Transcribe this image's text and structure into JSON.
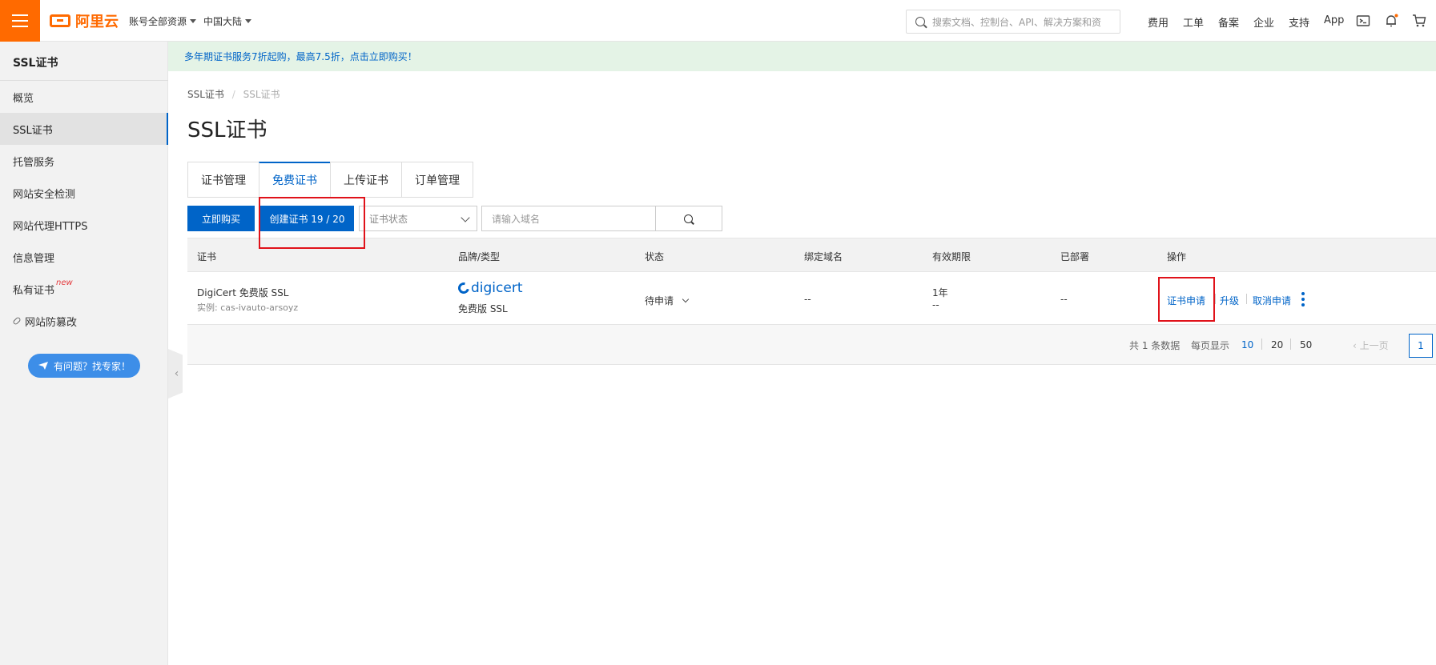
{
  "topbar": {
    "logo_text": "阿里云",
    "account_dropdown": "账号全部资源",
    "region_dropdown": "中国大陆",
    "search_placeholder": "搜索文档、控制台、API、解决方案和资",
    "links": [
      "费用",
      "工单",
      "备案",
      "企业",
      "支持",
      "App"
    ],
    "brand_color": "#ff6a00"
  },
  "sidebar": {
    "title": "SSL证书",
    "items": [
      {
        "label": "概览"
      },
      {
        "label": "SSL证书"
      },
      {
        "label": "托管服务"
      },
      {
        "label": "网站安全检测"
      },
      {
        "label": "网站代理HTTPS"
      },
      {
        "label": "信息管理"
      },
      {
        "label": "私有证书",
        "badge": "new"
      },
      {
        "label": "网站防篡改"
      }
    ],
    "expert_button": "有问题？找专家！"
  },
  "banner": {
    "text": "多年期证书服务7折起购，最高7.5折，点击立即购买！"
  },
  "breadcrumb": {
    "root": "SSL证书",
    "current": "SSL证书"
  },
  "page_title": "SSL证书",
  "tabs": [
    {
      "label": "证书管理"
    },
    {
      "label": "免费证书"
    },
    {
      "label": "上传证书"
    },
    {
      "label": "订单管理"
    }
  ],
  "toolbar": {
    "buy_button": "立即购买",
    "create_button": "创建证书 19 / 20",
    "status_select": "证书状态",
    "domain_placeholder": "请输入域名"
  },
  "table": {
    "headers": [
      "证书",
      "品牌/类型",
      "状态",
      "绑定域名",
      "有效期限",
      "已部署",
      "操作"
    ],
    "rows": [
      {
        "cert_name": "DigiCert 免费版 SSL",
        "instance": "实例: cas-ivauto-arsoyz",
        "brand_logo": "digicert",
        "brand_type": "免费版 SSL",
        "status": "待申请",
        "domain": "--",
        "validity": "1年",
        "validity_sub": "--",
        "deployed": "--",
        "actions": [
          "证书申请",
          "升级",
          "取消申请"
        ]
      }
    ]
  },
  "pagination": {
    "total_text": "共 1 条数据",
    "per_page_label": "每页显示",
    "sizes": [
      "10",
      "20",
      "50"
    ],
    "prev": "上一页",
    "current_page": "1"
  },
  "accent_color": "#0064c8",
  "highlight_color": "#e0121a"
}
